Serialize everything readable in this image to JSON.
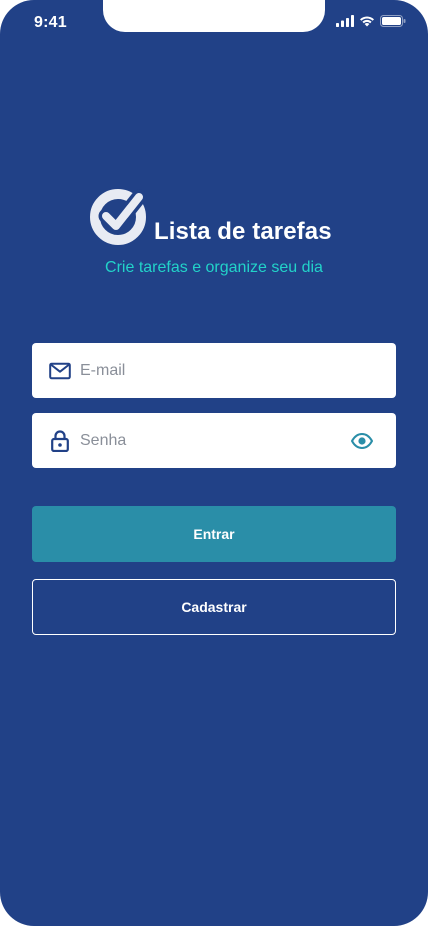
{
  "status_bar": {
    "time": "9:41",
    "icons": [
      "signal-icon",
      "wifi-icon",
      "battery-icon"
    ]
  },
  "brand": {
    "logo_icon": "check-circle-icon",
    "title": "Lista de tarefas",
    "subtitle": "Crie tarefas e organize seu dia"
  },
  "form": {
    "email": {
      "icon": "mail-icon",
      "placeholder": "E-mail",
      "value": ""
    },
    "password": {
      "icon": "lock-icon",
      "placeholder": "Senha",
      "value": "",
      "toggle_icon": "eye-icon"
    }
  },
  "buttons": {
    "login_label": "Entrar",
    "register_label": "Cadastrar"
  },
  "colors": {
    "background": "#214187",
    "accent_text": "#22d3c9",
    "primary_button": "#2a8ea8",
    "icon_dark": "#214187",
    "icon_teal": "#2a8ea8"
  }
}
